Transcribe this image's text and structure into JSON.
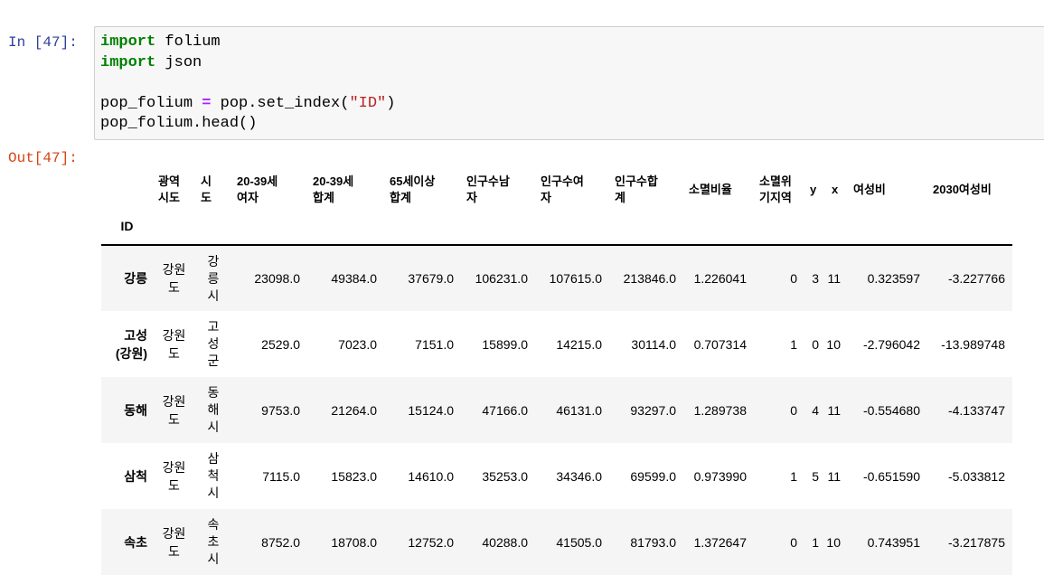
{
  "cell": {
    "in_prompt": "In [47]:",
    "out_prompt": "Out[47]:",
    "code": {
      "line1_kw": "import",
      "line1_rest": " folium",
      "line2_kw": "import",
      "line2_rest": " json",
      "line4_a": "pop_folium ",
      "line4_op": "=",
      "line4_b": " pop.set_index(",
      "line4_str": "\"ID\"",
      "line4_c": ")",
      "line5": "pop_folium.head()"
    }
  },
  "dataframe": {
    "index_name": "ID",
    "columns": [
      [
        "광역",
        "시도"
      ],
      [
        "시",
        "도"
      ],
      [
        "20-39세",
        "여자"
      ],
      [
        "20-39세",
        "합계"
      ],
      [
        "65세이상",
        "합계"
      ],
      [
        "인구수남",
        "자"
      ],
      [
        "인구수여",
        "자"
      ],
      [
        "인구수합",
        "계"
      ],
      [
        "소멸비율"
      ],
      [
        "소멸위",
        "기지역"
      ],
      [
        "y"
      ],
      [
        "x"
      ],
      [
        "여성비"
      ],
      [
        "2030여성비"
      ]
    ],
    "rows": [
      {
        "index": [
          "강릉"
        ],
        "sido": [
          "강원",
          "도"
        ],
        "si": [
          "강",
          "릉",
          "시"
        ],
        "values": [
          "23098.0",
          "49384.0",
          "37679.0",
          "106231.0",
          "107615.0",
          "213846.0",
          "1.226041",
          "0",
          "3",
          "11",
          "0.323597",
          "-3.227766"
        ]
      },
      {
        "index": [
          "고성",
          "(강원)"
        ],
        "sido": [
          "강원",
          "도"
        ],
        "si": [
          "고",
          "성",
          "군"
        ],
        "values": [
          "2529.0",
          "7023.0",
          "7151.0",
          "15899.0",
          "14215.0",
          "30114.0",
          "0.707314",
          "1",
          "0",
          "10",
          "-2.796042",
          "-13.989748"
        ]
      },
      {
        "index": [
          "동해"
        ],
        "sido": [
          "강원",
          "도"
        ],
        "si": [
          "동",
          "해",
          "시"
        ],
        "values": [
          "9753.0",
          "21264.0",
          "15124.0",
          "47166.0",
          "46131.0",
          "93297.0",
          "1.289738",
          "0",
          "4",
          "11",
          "-0.554680",
          "-4.133747"
        ]
      },
      {
        "index": [
          "삼척"
        ],
        "sido": [
          "강원",
          "도"
        ],
        "si": [
          "삼",
          "척",
          "시"
        ],
        "values": [
          "7115.0",
          "15823.0",
          "14610.0",
          "35253.0",
          "34346.0",
          "69599.0",
          "0.973990",
          "1",
          "5",
          "11",
          "-0.651590",
          "-5.033812"
        ]
      },
      {
        "index": [
          "속초"
        ],
        "sido": [
          "강원",
          "도"
        ],
        "si": [
          "속",
          "초",
          "시"
        ],
        "values": [
          "8752.0",
          "18708.0",
          "12752.0",
          "40288.0",
          "41505.0",
          "81793.0",
          "1.372647",
          "0",
          "1",
          "10",
          "0.743951",
          "-3.217875"
        ]
      }
    ]
  }
}
